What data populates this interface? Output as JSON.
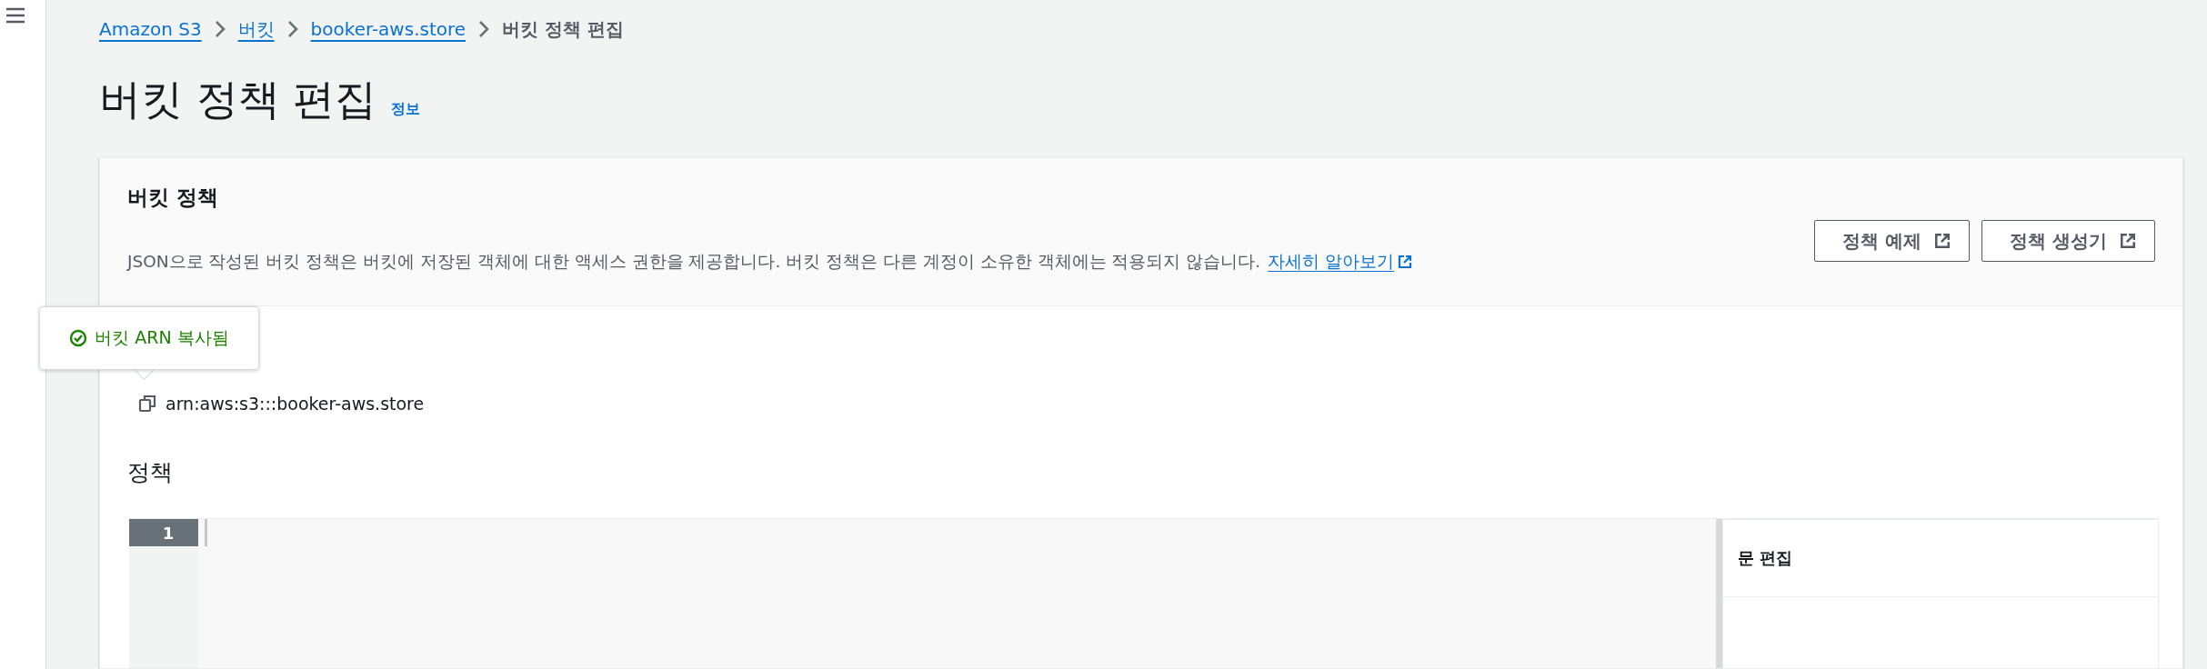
{
  "breadcrumbs": [
    {
      "label": "Amazon S3",
      "kind": "link"
    },
    {
      "label": "버킷",
      "kind": "link"
    },
    {
      "label": "booker-aws.store",
      "kind": "link"
    },
    {
      "label": "버킷 정책 편집",
      "kind": "current"
    }
  ],
  "page": {
    "title": "버킷 정책 편집",
    "info_link": "정보"
  },
  "card": {
    "title": "버킷 정책",
    "description": "JSON으로 작성된 버킷 정책은 버킷에 저장된 객체에 대한 액세스 권한을 제공합니다. 버킷 정책은 다른 계정이 소유한 객체에는 적용되지 않습니다.",
    "learn_more_link": "자세히 알아보기",
    "buttons": [
      {
        "label": "정책 예제"
      },
      {
        "label": "정책 생성기"
      }
    ]
  },
  "tooltip": {
    "text": "버킷 ARN 복사됨"
  },
  "arn": "arn:aws:s3:::booker-aws.store",
  "policy": {
    "heading": "정책",
    "lines": [
      {
        "number": "1",
        "active": true
      }
    ],
    "side_panel": {
      "title": "문 편집"
    }
  }
}
